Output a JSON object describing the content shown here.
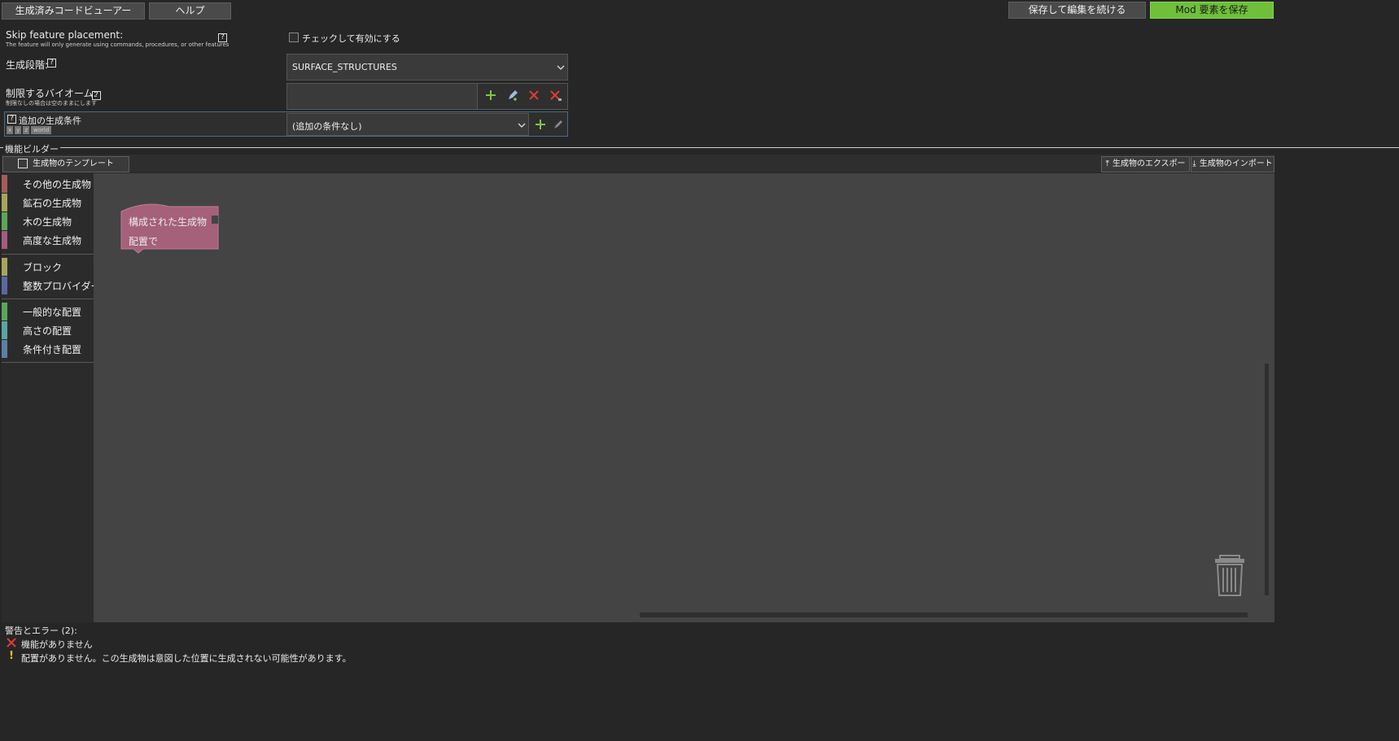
{
  "toolbar": {
    "code_viewer": "生成済みコードビューアー",
    "help": "ヘルプ",
    "save_continue": "保存して編集を続ける",
    "save_mod": "Mod 要素を保存"
  },
  "form": {
    "skip_title": "Skip feature placement:",
    "skip_desc": "The feature will only generate using commands, procedures, or other features",
    "skip_checkbox": "チェックして有効にする",
    "stage_label": "生成段階:",
    "stage_value": "SURFACE_STRUCTURES",
    "biome_label": "制限するバイオーム:",
    "biome_desc": "制限なしの場合は空のままにします",
    "cond_label": "追加の生成条件",
    "cond_tags": [
      "x",
      "y",
      "z",
      "world"
    ],
    "cond_value": "(追加の条件なし)",
    "help_mark": "?"
  },
  "builder": {
    "title": "機能ビルダー",
    "templates": "生成物のテンプレート",
    "export": "生成物のエクスポート",
    "import": "生成物のインポート",
    "block_line1": "構成された生成物",
    "block_line2": "配置で"
  },
  "categories": [
    {
      "label": "その他の生成物",
      "color": "#a55b5b"
    },
    {
      "label": "鉱石の生成物",
      "color": "#a5a55b"
    },
    {
      "label": "木の生成物",
      "color": "#5ba55b"
    },
    {
      "label": "高度な生成物",
      "color": "#a55b80"
    },
    {
      "label": "ブロック",
      "color": "#a5a55b"
    },
    {
      "label": "整数プロバイダー",
      "color": "#5b67a5"
    },
    {
      "label": "一般的な配置",
      "color": "#5ba55b"
    },
    {
      "label": "高さの配置",
      "color": "#5ba5a5"
    },
    {
      "label": "条件付き配置",
      "color": "#5b80a5"
    }
  ],
  "warnings": {
    "header": "警告とエラー (2):",
    "items": [
      {
        "type": "error",
        "text": "機能がありません"
      },
      {
        "type": "warning",
        "text": "配置がありません。この生成物は意図した位置に生成されない可能性があります。"
      }
    ]
  },
  "colors": {
    "accent_green": "#6fbf3b",
    "block_pink": "#a5607a",
    "workspace": "#444444"
  },
  "icons": [
    "add-icon",
    "edit-icon",
    "remove-icon",
    "remove-all-icon",
    "template-icon",
    "export-icon",
    "import-icon",
    "trash-icon",
    "error-icon",
    "warning-icon",
    "dropdown-arrow-icon"
  ]
}
